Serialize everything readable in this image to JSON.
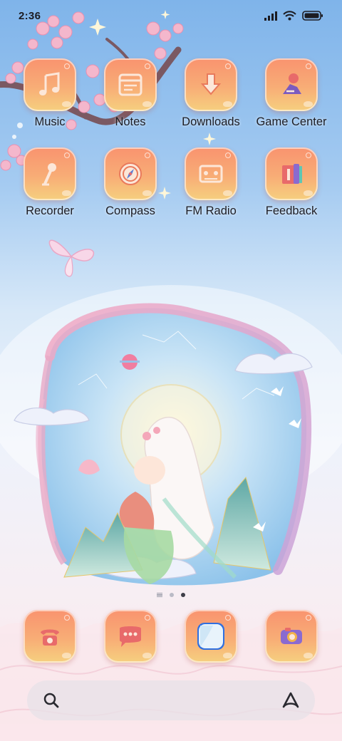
{
  "status_bar": {
    "time": "2:36",
    "icons": [
      "signal-icon",
      "wifi-icon",
      "battery-icon"
    ]
  },
  "home_apps": [
    {
      "label": "Music",
      "icon": "music-note-icon"
    },
    {
      "label": "Notes",
      "icon": "notes-icon"
    },
    {
      "label": "Downloads",
      "icon": "download-arrow-icon"
    },
    {
      "label": "Game Center",
      "icon": "game-center-icon"
    },
    {
      "label": "Recorder",
      "icon": "microphone-icon"
    },
    {
      "label": "Compass",
      "icon": "compass-icon"
    },
    {
      "label": "FM Radio",
      "icon": "radio-cassette-icon"
    },
    {
      "label": "Feedback",
      "icon": "feedback-book-icon"
    }
  ],
  "page_indicator": {
    "pages": 2,
    "current": 2
  },
  "dock": [
    {
      "icon": "phone-icon"
    },
    {
      "icon": "messages-icon"
    },
    {
      "icon": "browser-icon"
    },
    {
      "icon": "camera-icon"
    }
  ],
  "search": {
    "left_icon": "search-icon",
    "right_icon": "assistant-icon"
  },
  "colors": {
    "tile_top": "#f9936f",
    "tile_bottom": "#f6d07f",
    "sky": "#7fb4ea",
    "petal": "#f4b7cc"
  }
}
